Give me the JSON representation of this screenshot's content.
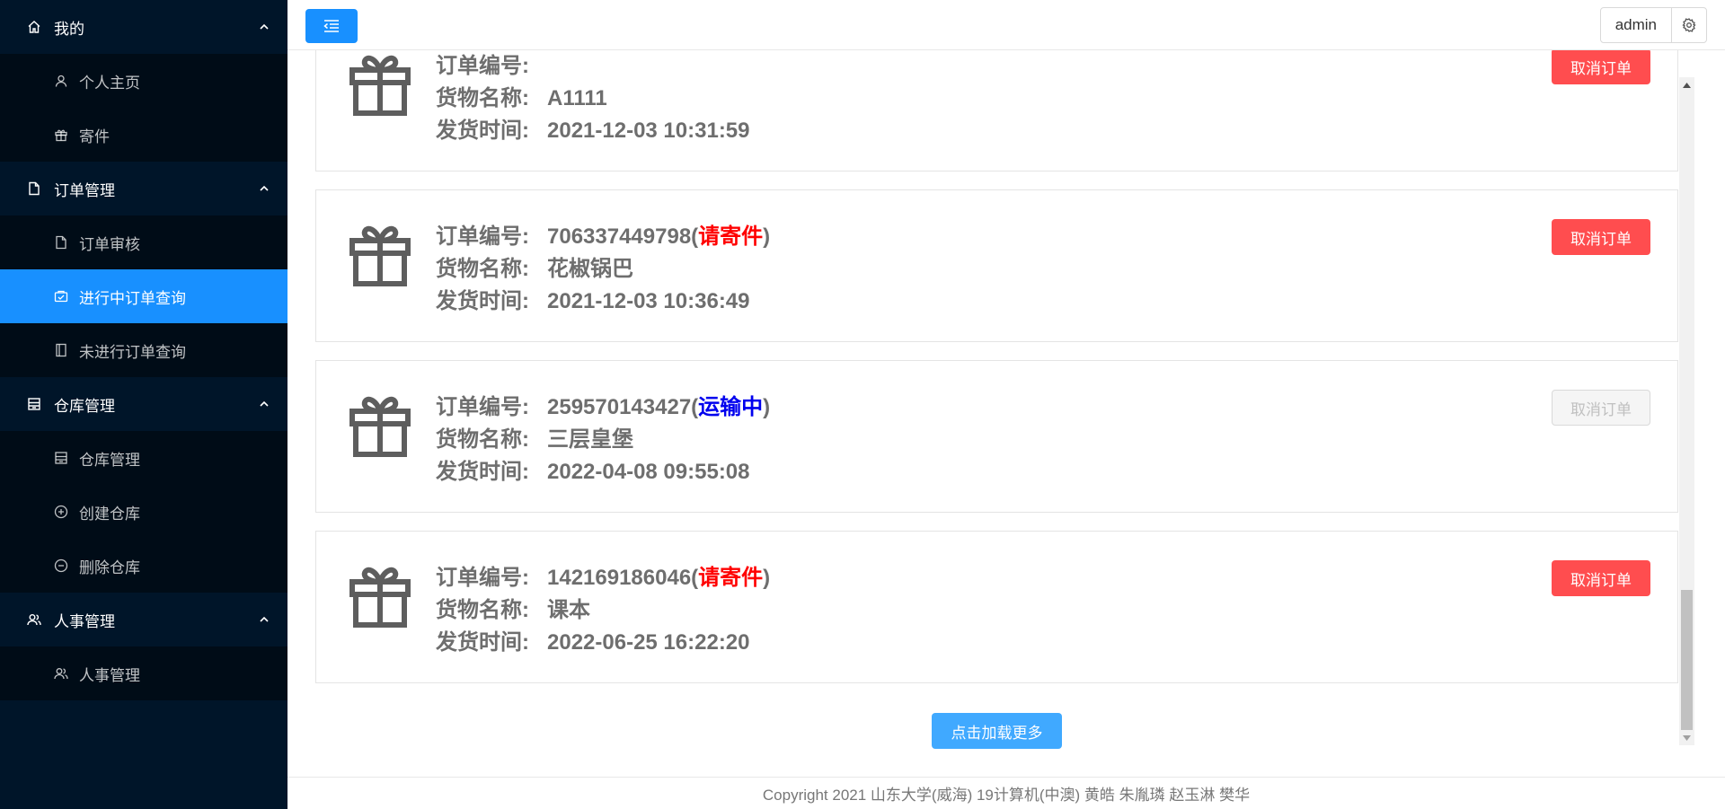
{
  "sidebar": {
    "groups": [
      {
        "label": "我的",
        "items": [
          {
            "label": "个人主页"
          },
          {
            "label": "寄件"
          }
        ]
      },
      {
        "label": "订单管理",
        "items": [
          {
            "label": "订单审核"
          },
          {
            "label": "进行中订单查询"
          },
          {
            "label": "未进行订单查询"
          }
        ]
      },
      {
        "label": "仓库管理",
        "items": [
          {
            "label": "仓库管理"
          },
          {
            "label": "创建仓库"
          },
          {
            "label": "删除仓库"
          }
        ]
      },
      {
        "label": "人事管理",
        "items": [
          {
            "label": "人事管理"
          }
        ]
      }
    ],
    "active_item": "进行中订单查询"
  },
  "header": {
    "user_name": "admin"
  },
  "labels": {
    "order_no": "订单编号:",
    "goods_name": "货物名称:",
    "ship_time": "发货时间:"
  },
  "orders": [
    {
      "order_no": "",
      "status": "",
      "goods_name": "A1111",
      "ship_time": "2021-12-03 10:31:59",
      "cancel_label": "取消订单",
      "cancel_enabled": true
    },
    {
      "order_no": "706337449798",
      "status": "请寄件",
      "goods_name": "花椒锅巴",
      "ship_time": "2021-12-03 10:36:49",
      "cancel_label": "取消订单",
      "cancel_enabled": true
    },
    {
      "order_no": "259570143427",
      "status": "运输中",
      "goods_name": "三层皇堡",
      "ship_time": "2022-04-08 09:55:08",
      "cancel_label": "取消订单",
      "cancel_enabled": false
    },
    {
      "order_no": "142169186046",
      "status": "请寄件",
      "goods_name": "课本",
      "ship_time": "2022-06-25 16:22:20",
      "cancel_label": "取消订单",
      "cancel_enabled": true
    }
  ],
  "load_more_label": "点击加载更多",
  "footer": {
    "copyright": "Copyright 2021 山东大学(威海) 19计算机(中澳) 黄皓 朱胤璘 赵玉淋 樊华"
  },
  "colors": {
    "sidebar_bg": "#001529",
    "submenu_bg": "#000c17",
    "primary": "#1890ff",
    "danger": "#ff4d4f",
    "status_pending": "#ff0000",
    "status_transit": "#0000ee"
  },
  "icons": {
    "group_0": "home-icon",
    "group_1": "file-icon",
    "group_2": "warehouse-icon",
    "group_3": "users-icon",
    "order_card": "gift-icon",
    "header_toggle": "menu-fold-icon",
    "header_settings": "gear-icon"
  }
}
